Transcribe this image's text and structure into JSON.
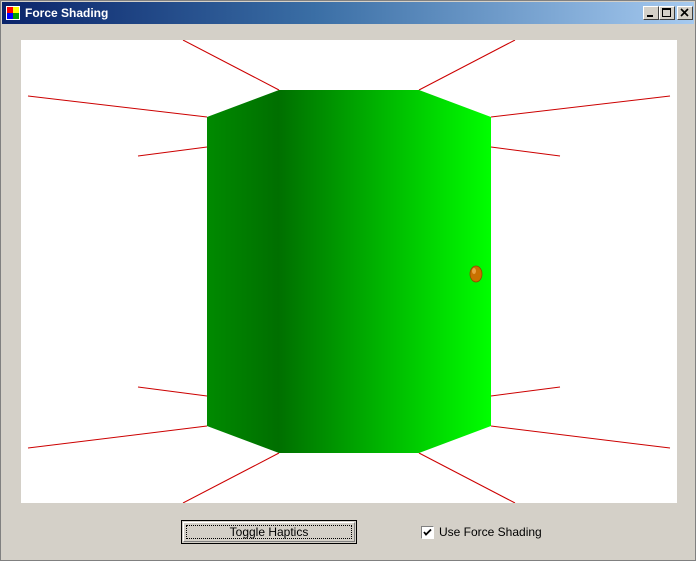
{
  "window": {
    "title": "Force Shading"
  },
  "controls": {
    "toggle_button_label": "Toggle Haptics",
    "checkbox_label": "Use Force Shading",
    "checkbox_checked": true
  },
  "scene": {
    "shape_color_dark": "#007000",
    "shape_color_light": "#00ff00",
    "line_color": "#cc0000",
    "cursor_color": "#c87000"
  }
}
